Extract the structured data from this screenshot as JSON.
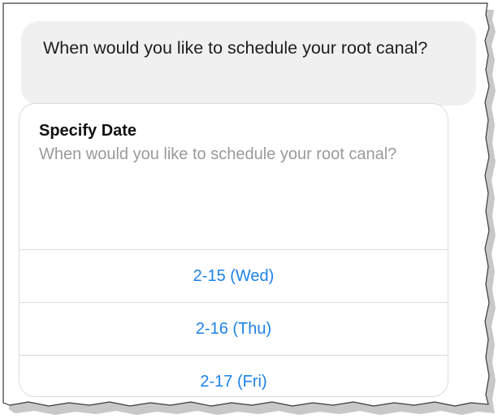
{
  "chat": {
    "message": "When would you like to schedule your root canal?"
  },
  "card": {
    "title": "Specify Date",
    "subtitle": "When would you like to schedule your root canal?",
    "options": [
      {
        "label": "2-15 (Wed)"
      },
      {
        "label": "2-16 (Thu)"
      },
      {
        "label": "2-17 (Fri)"
      }
    ]
  },
  "colors": {
    "bubble_bg": "#f1f0f0",
    "option_link": "#1d82e6",
    "subtitle_gray": "#9a9a9a",
    "divider": "#dcdcdc"
  }
}
